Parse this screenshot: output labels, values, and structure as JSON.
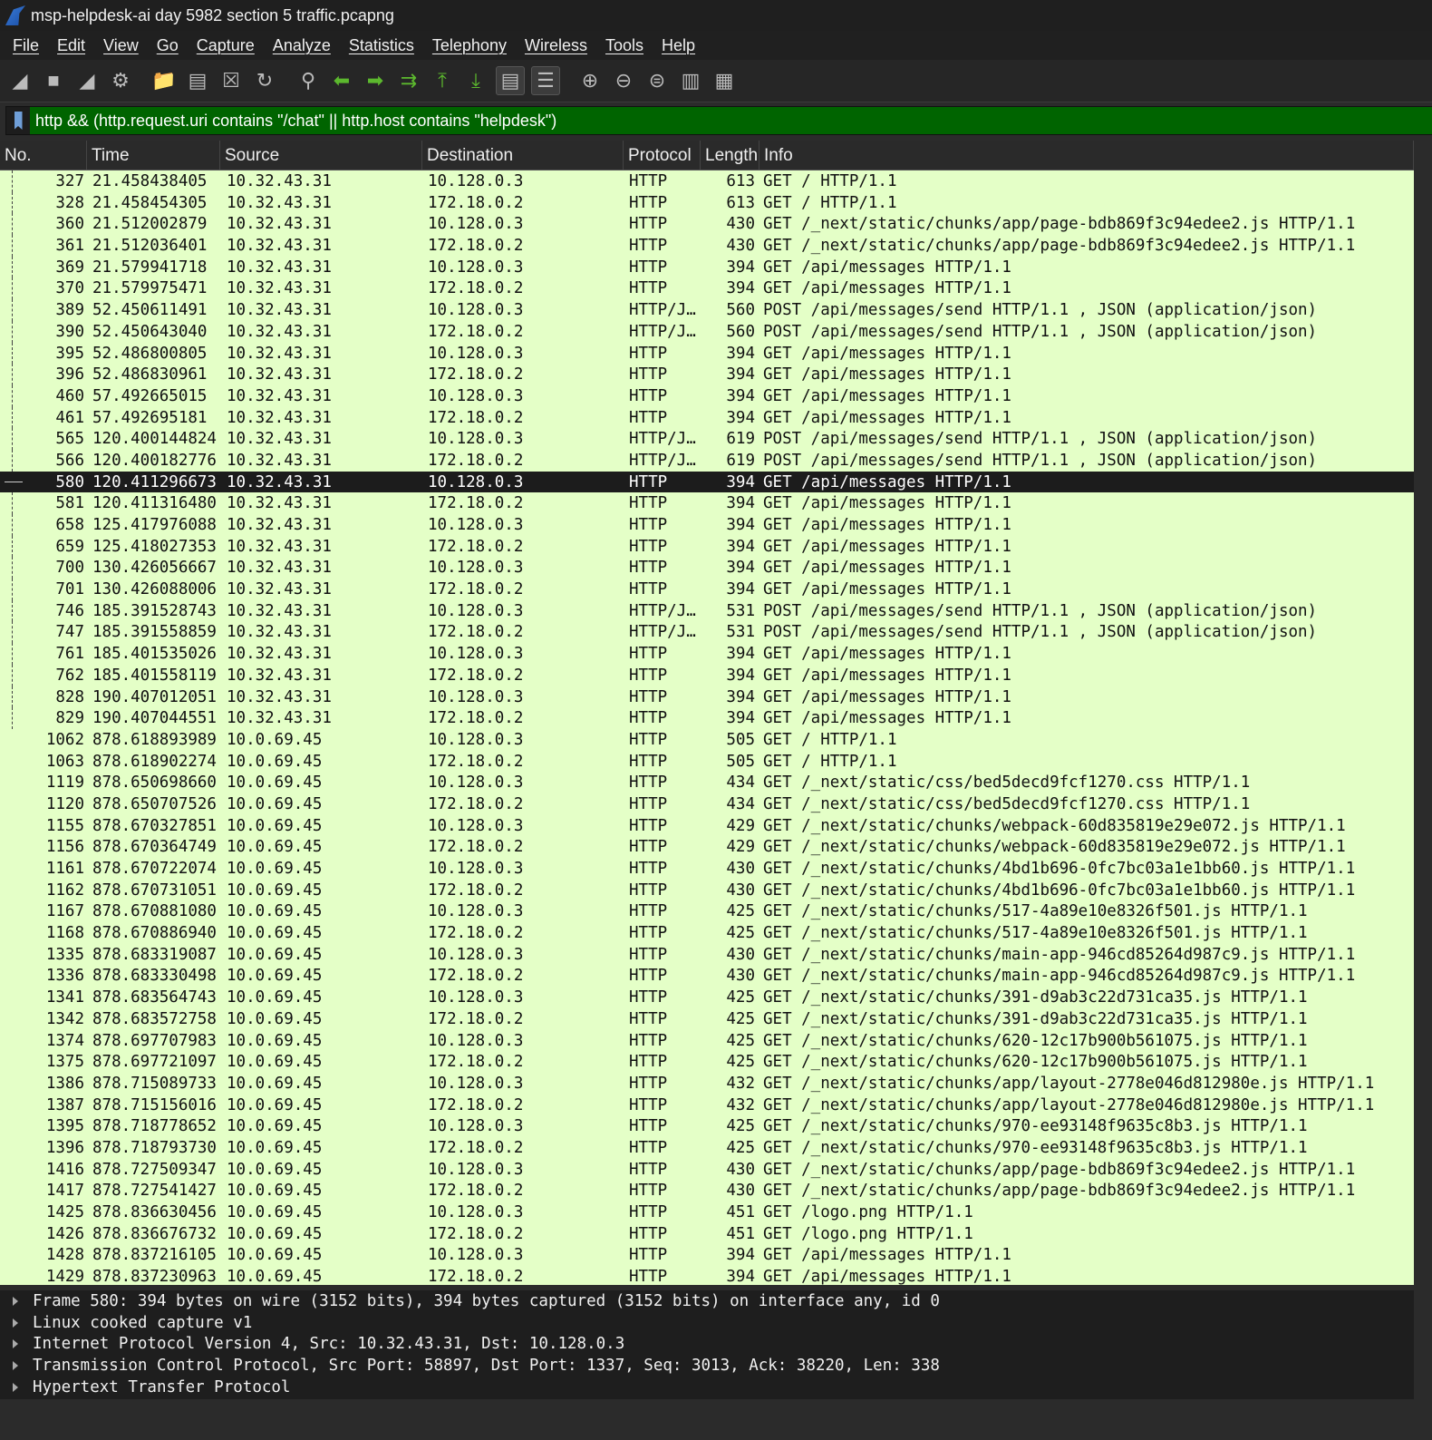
{
  "window": {
    "title": "msp-helpdesk-ai day 5982  section 5 traffic.pcapng"
  },
  "menu": [
    "File",
    "Edit",
    "View",
    "Go",
    "Capture",
    "Analyze",
    "Statistics",
    "Telephony",
    "Wireless",
    "Tools",
    "Help"
  ],
  "toolbar": {
    "icons": [
      "start-capture-icon",
      "stop-capture-icon",
      "restart-capture-icon",
      "capture-options-icon",
      "open-file-icon",
      "save-file-icon",
      "close-file-icon",
      "reload-file-icon",
      "find-packet-icon",
      "go-back-icon",
      "go-forward-icon",
      "go-to-packet-icon",
      "go-first-icon",
      "go-last-icon",
      "auto-scroll-icon",
      "colorize-icon",
      "zoom-in-icon",
      "zoom-out-icon",
      "zoom-normal-icon",
      "resize-columns-icon",
      "layout-icon"
    ]
  },
  "filter": {
    "value": "http && (http.request.uri contains \"/chat\" || http.host contains \"helpdesk\")"
  },
  "columns": [
    "No.",
    "Time",
    "Source",
    "Destination",
    "Protocol",
    "Length",
    "Info"
  ],
  "colors": {
    "row_bg": "#e4ffc7",
    "selected_bg": "#1c1c1c",
    "filter_bg": "#006400"
  },
  "selected_packet": "580",
  "packets": [
    [
      "327",
      "21.458438405",
      "10.32.43.31",
      "10.128.0.3",
      "HTTP",
      "613",
      "GET / HTTP/1.1"
    ],
    [
      "328",
      "21.458454305",
      "10.32.43.31",
      "172.18.0.2",
      "HTTP",
      "613",
      "GET / HTTP/1.1"
    ],
    [
      "360",
      "21.512002879",
      "10.32.43.31",
      "10.128.0.3",
      "HTTP",
      "430",
      "GET /_next/static/chunks/app/page-bdb869f3c94edee2.js HTTP/1.1"
    ],
    [
      "361",
      "21.512036401",
      "10.32.43.31",
      "172.18.0.2",
      "HTTP",
      "430",
      "GET /_next/static/chunks/app/page-bdb869f3c94edee2.js HTTP/1.1"
    ],
    [
      "369",
      "21.579941718",
      "10.32.43.31",
      "10.128.0.3",
      "HTTP",
      "394",
      "GET /api/messages HTTP/1.1"
    ],
    [
      "370",
      "21.579975471",
      "10.32.43.31",
      "172.18.0.2",
      "HTTP",
      "394",
      "GET /api/messages HTTP/1.1"
    ],
    [
      "389",
      "52.450611491",
      "10.32.43.31",
      "10.128.0.3",
      "HTTP/J…",
      "560",
      "POST /api/messages/send HTTP/1.1 , JSON (application/json)"
    ],
    [
      "390",
      "52.450643040",
      "10.32.43.31",
      "172.18.0.2",
      "HTTP/J…",
      "560",
      "POST /api/messages/send HTTP/1.1 , JSON (application/json)"
    ],
    [
      "395",
      "52.486800805",
      "10.32.43.31",
      "10.128.0.3",
      "HTTP",
      "394",
      "GET /api/messages HTTP/1.1"
    ],
    [
      "396",
      "52.486830961",
      "10.32.43.31",
      "172.18.0.2",
      "HTTP",
      "394",
      "GET /api/messages HTTP/1.1"
    ],
    [
      "460",
      "57.492665015",
      "10.32.43.31",
      "10.128.0.3",
      "HTTP",
      "394",
      "GET /api/messages HTTP/1.1"
    ],
    [
      "461",
      "57.492695181",
      "10.32.43.31",
      "172.18.0.2",
      "HTTP",
      "394",
      "GET /api/messages HTTP/1.1"
    ],
    [
      "565",
      "120.400144824",
      "10.32.43.31",
      "10.128.0.3",
      "HTTP/J…",
      "619",
      "POST /api/messages/send HTTP/1.1 , JSON (application/json)"
    ],
    [
      "566",
      "120.400182776",
      "10.32.43.31",
      "172.18.0.2",
      "HTTP/J…",
      "619",
      "POST /api/messages/send HTTP/1.1 , JSON (application/json)"
    ],
    [
      "580",
      "120.411296673",
      "10.32.43.31",
      "10.128.0.3",
      "HTTP",
      "394",
      "GET /api/messages HTTP/1.1"
    ],
    [
      "581",
      "120.411316480",
      "10.32.43.31",
      "172.18.0.2",
      "HTTP",
      "394",
      "GET /api/messages HTTP/1.1"
    ],
    [
      "658",
      "125.417976088",
      "10.32.43.31",
      "10.128.0.3",
      "HTTP",
      "394",
      "GET /api/messages HTTP/1.1"
    ],
    [
      "659",
      "125.418027353",
      "10.32.43.31",
      "172.18.0.2",
      "HTTP",
      "394",
      "GET /api/messages HTTP/1.1"
    ],
    [
      "700",
      "130.426056667",
      "10.32.43.31",
      "10.128.0.3",
      "HTTP",
      "394",
      "GET /api/messages HTTP/1.1"
    ],
    [
      "701",
      "130.426088006",
      "10.32.43.31",
      "172.18.0.2",
      "HTTP",
      "394",
      "GET /api/messages HTTP/1.1"
    ],
    [
      "746",
      "185.391528743",
      "10.32.43.31",
      "10.128.0.3",
      "HTTP/J…",
      "531",
      "POST /api/messages/send HTTP/1.1 , JSON (application/json)"
    ],
    [
      "747",
      "185.391558859",
      "10.32.43.31",
      "172.18.0.2",
      "HTTP/J…",
      "531",
      "POST /api/messages/send HTTP/1.1 , JSON (application/json)"
    ],
    [
      "761",
      "185.401535026",
      "10.32.43.31",
      "10.128.0.3",
      "HTTP",
      "394",
      "GET /api/messages HTTP/1.1"
    ],
    [
      "762",
      "185.401558119",
      "10.32.43.31",
      "172.18.0.2",
      "HTTP",
      "394",
      "GET /api/messages HTTP/1.1"
    ],
    [
      "828",
      "190.407012051",
      "10.32.43.31",
      "10.128.0.3",
      "HTTP",
      "394",
      "GET /api/messages HTTP/1.1"
    ],
    [
      "829",
      "190.407044551",
      "10.32.43.31",
      "172.18.0.2",
      "HTTP",
      "394",
      "GET /api/messages HTTP/1.1"
    ],
    [
      "1062",
      "878.618893989",
      "10.0.69.45",
      "10.128.0.3",
      "HTTP",
      "505",
      "GET / HTTP/1.1"
    ],
    [
      "1063",
      "878.618902274",
      "10.0.69.45",
      "172.18.0.2",
      "HTTP",
      "505",
      "GET / HTTP/1.1"
    ],
    [
      "1119",
      "878.650698660",
      "10.0.69.45",
      "10.128.0.3",
      "HTTP",
      "434",
      "GET /_next/static/css/bed5decd9fcf1270.css HTTP/1.1"
    ],
    [
      "1120",
      "878.650707526",
      "10.0.69.45",
      "172.18.0.2",
      "HTTP",
      "434",
      "GET /_next/static/css/bed5decd9fcf1270.css HTTP/1.1"
    ],
    [
      "1155",
      "878.670327851",
      "10.0.69.45",
      "10.128.0.3",
      "HTTP",
      "429",
      "GET /_next/static/chunks/webpack-60d835819e29e072.js HTTP/1.1"
    ],
    [
      "1156",
      "878.670364749",
      "10.0.69.45",
      "172.18.0.2",
      "HTTP",
      "429",
      "GET /_next/static/chunks/webpack-60d835819e29e072.js HTTP/1.1"
    ],
    [
      "1161",
      "878.670722074",
      "10.0.69.45",
      "10.128.0.3",
      "HTTP",
      "430",
      "GET /_next/static/chunks/4bd1b696-0fc7bc03a1e1bb60.js HTTP/1.1"
    ],
    [
      "1162",
      "878.670731051",
      "10.0.69.45",
      "172.18.0.2",
      "HTTP",
      "430",
      "GET /_next/static/chunks/4bd1b696-0fc7bc03a1e1bb60.js HTTP/1.1"
    ],
    [
      "1167",
      "878.670881080",
      "10.0.69.45",
      "10.128.0.3",
      "HTTP",
      "425",
      "GET /_next/static/chunks/517-4a89e10e8326f501.js HTTP/1.1"
    ],
    [
      "1168",
      "878.670886940",
      "10.0.69.45",
      "172.18.0.2",
      "HTTP",
      "425",
      "GET /_next/static/chunks/517-4a89e10e8326f501.js HTTP/1.1"
    ],
    [
      "1335",
      "878.683319087",
      "10.0.69.45",
      "10.128.0.3",
      "HTTP",
      "430",
      "GET /_next/static/chunks/main-app-946cd85264d987c9.js HTTP/1.1"
    ],
    [
      "1336",
      "878.683330498",
      "10.0.69.45",
      "172.18.0.2",
      "HTTP",
      "430",
      "GET /_next/static/chunks/main-app-946cd85264d987c9.js HTTP/1.1"
    ],
    [
      "1341",
      "878.683564743",
      "10.0.69.45",
      "10.128.0.3",
      "HTTP",
      "425",
      "GET /_next/static/chunks/391-d9ab3c22d731ca35.js HTTP/1.1"
    ],
    [
      "1342",
      "878.683572758",
      "10.0.69.45",
      "172.18.0.2",
      "HTTP",
      "425",
      "GET /_next/static/chunks/391-d9ab3c22d731ca35.js HTTP/1.1"
    ],
    [
      "1374",
      "878.697707983",
      "10.0.69.45",
      "10.128.0.3",
      "HTTP",
      "425",
      "GET /_next/static/chunks/620-12c17b900b561075.js HTTP/1.1"
    ],
    [
      "1375",
      "878.697721097",
      "10.0.69.45",
      "172.18.0.2",
      "HTTP",
      "425",
      "GET /_next/static/chunks/620-12c17b900b561075.js HTTP/1.1"
    ],
    [
      "1386",
      "878.715089733",
      "10.0.69.45",
      "10.128.0.3",
      "HTTP",
      "432",
      "GET /_next/static/chunks/app/layout-2778e046d812980e.js HTTP/1.1"
    ],
    [
      "1387",
      "878.715156016",
      "10.0.69.45",
      "172.18.0.2",
      "HTTP",
      "432",
      "GET /_next/static/chunks/app/layout-2778e046d812980e.js HTTP/1.1"
    ],
    [
      "1395",
      "878.718778652",
      "10.0.69.45",
      "10.128.0.3",
      "HTTP",
      "425",
      "GET /_next/static/chunks/970-ee93148f9635c8b3.js HTTP/1.1"
    ],
    [
      "1396",
      "878.718793730",
      "10.0.69.45",
      "172.18.0.2",
      "HTTP",
      "425",
      "GET /_next/static/chunks/970-ee93148f9635c8b3.js HTTP/1.1"
    ],
    [
      "1416",
      "878.727509347",
      "10.0.69.45",
      "10.128.0.3",
      "HTTP",
      "430",
      "GET /_next/static/chunks/app/page-bdb869f3c94edee2.js HTTP/1.1"
    ],
    [
      "1417",
      "878.727541427",
      "10.0.69.45",
      "172.18.0.2",
      "HTTP",
      "430",
      "GET /_next/static/chunks/app/page-bdb869f3c94edee2.js HTTP/1.1"
    ],
    [
      "1425",
      "878.836630456",
      "10.0.69.45",
      "10.128.0.3",
      "HTTP",
      "451",
      "GET /logo.png HTTP/1.1"
    ],
    [
      "1426",
      "878.836676732",
      "10.0.69.45",
      "172.18.0.2",
      "HTTP",
      "451",
      "GET /logo.png HTTP/1.1"
    ],
    [
      "1428",
      "878.837216105",
      "10.0.69.45",
      "10.128.0.3",
      "HTTP",
      "394",
      "GET /api/messages HTTP/1.1"
    ],
    [
      "1429",
      "878.837230963",
      "10.0.69.45",
      "172.18.0.2",
      "HTTP",
      "394",
      "GET /api/messages HTTP/1.1"
    ]
  ],
  "details": [
    "Frame 580: 394 bytes on wire (3152 bits), 394 bytes captured (3152 bits) on interface any, id 0",
    "Linux cooked capture v1",
    "Internet Protocol Version 4, Src: 10.32.43.31, Dst: 10.128.0.3",
    "Transmission Control Protocol, Src Port: 58897, Dst Port: 1337, Seq: 3013, Ack: 38220, Len: 338",
    "Hypertext Transfer Protocol"
  ]
}
